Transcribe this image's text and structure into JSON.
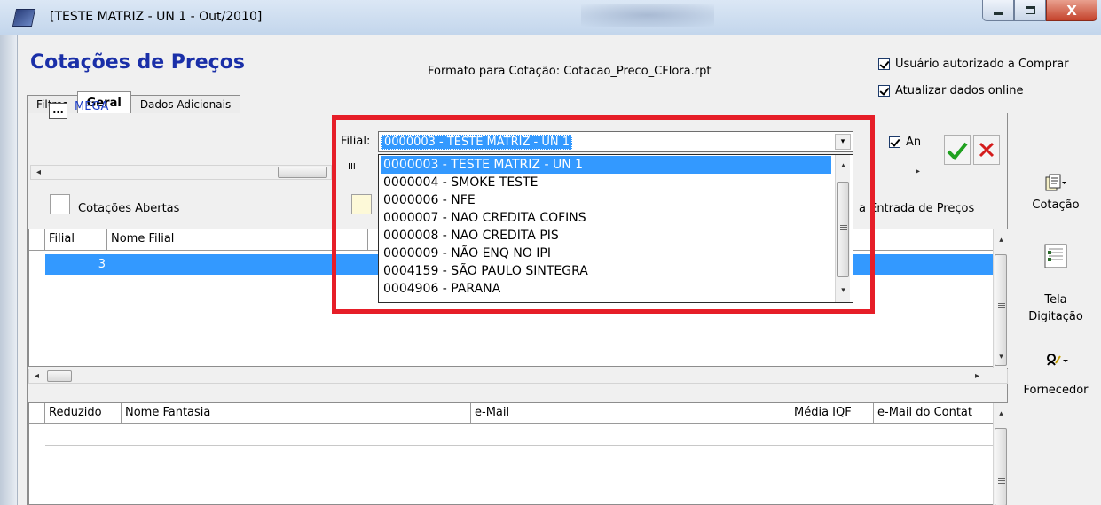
{
  "window": {
    "title": "[TESTE MATRIZ - UN 1 - Out/2010]",
    "close_glyph": "X"
  },
  "header": {
    "page_title": "Cotações de Preços",
    "format_label": "Formato para Cotação: Cotacao_Preco_CFlora.rpt",
    "checkbox_authorized": "Usuário autorizado a Comprar",
    "checkbox_online": "Atualizar dados online"
  },
  "tabs": [
    {
      "label": "Filtros"
    },
    {
      "label": "Geral"
    },
    {
      "label": "Dados Adicionais"
    }
  ],
  "filter": {
    "ellipsis": "...",
    "value": "MEGA",
    "filial_label": "Filial:",
    "filial_selected": "0000003 - TESTE MATRIZ - UN 1",
    "an_checkbox_label": "An"
  },
  "options": {
    "open_quotes": "Cotações Abertas",
    "price_entry": "a Entrada de Preços"
  },
  "filial_options": [
    "0000003 - TESTE MATRIZ - UN 1",
    "0000004 - SMOKE TESTE",
    "0000006 - NFE",
    "0000007 - NAO CREDITA COFINS",
    "0000008 - NAO CREDITA PIS",
    "0000009 - NÃO ENQ NO IPI",
    "0004159 - SÃO PAULO SINTEGRA",
    "0004906 - PARANA"
  ],
  "grid1": {
    "columns": [
      "Filial",
      "Nome Filial"
    ],
    "rows": [
      {
        "filial": "3",
        "nome": ""
      }
    ]
  },
  "grid2": {
    "columns": [
      "Reduzido",
      "Nome Fantasia",
      "e-Mail",
      "Média IQF",
      "e-Mail do Contat"
    ]
  },
  "toolbar": {
    "cotacao": "Cotação",
    "tela_line1": "Tela",
    "tela_line2": "Digitação",
    "fornecedor": "Fornecedor"
  },
  "scroll_glyphs": {
    "left": "◂",
    "right": "▸",
    "up": "▴",
    "down": "▾",
    "grip": "III"
  },
  "colors": {
    "selection": "#3399ff",
    "title_blue": "#1a2fa8",
    "highlight_red": "#e61e28",
    "mega_blue": "#1e3fc8"
  }
}
